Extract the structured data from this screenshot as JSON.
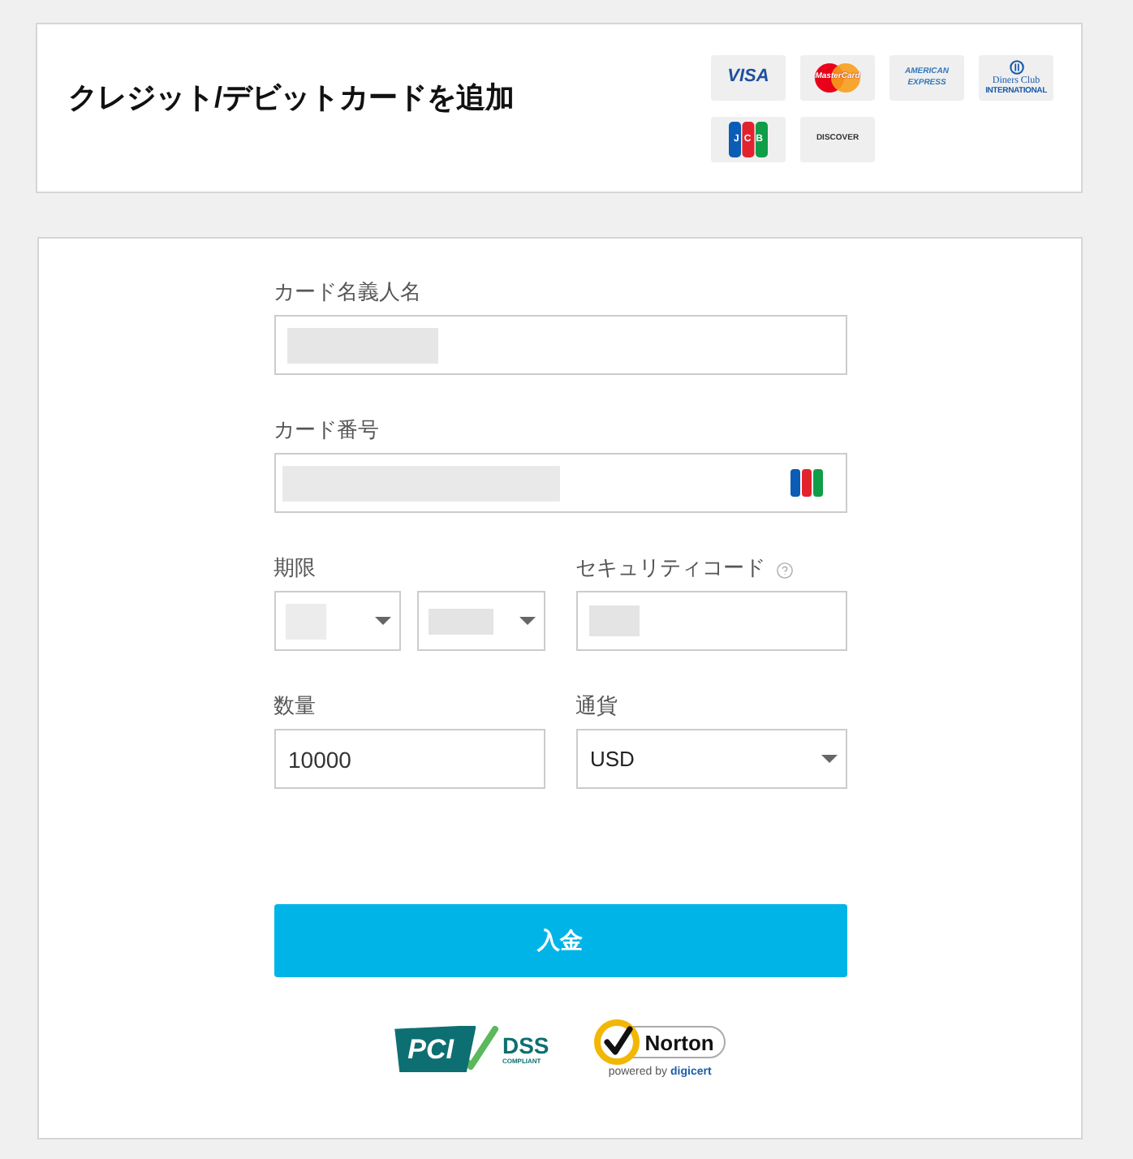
{
  "header": {
    "title": "クレジット/デビットカードを追加",
    "card_brands": [
      {
        "kind": "visa",
        "text": "VISA"
      },
      {
        "kind": "mastercard",
        "text": "MasterCard"
      },
      {
        "kind": "amex",
        "text": "AMERICAN EXPRESS"
      },
      {
        "kind": "diners",
        "text": "Diners Club",
        "subtext": "INTERNATIONAL"
      },
      {
        "kind": "jcb",
        "text": "JCB"
      },
      {
        "kind": "discover",
        "text": "DISCOVER"
      }
    ]
  },
  "form": {
    "cardholder": {
      "label": "カード名義人名",
      "masked": true
    },
    "card_number": {
      "label": "カード番号",
      "masked": true,
      "card_icon": true
    },
    "expiry": {
      "label": "期限",
      "selects": [
        {
          "masked": true
        },
        {
          "masked": true
        }
      ]
    },
    "security_code": {
      "label": "セキュリティコード",
      "help": true,
      "masked": true
    },
    "amount": {
      "label": "数量",
      "value": "10000"
    },
    "currency": {
      "label": "通貨",
      "value": "USD"
    },
    "submit": {
      "label": "入金"
    }
  },
  "trust_badges": [
    {
      "kind": "pci",
      "mark": "PCI",
      "text": "DSS",
      "subtext": "COMPLIANT"
    },
    {
      "kind": "norton",
      "text": "Norton",
      "subtext": "powered by",
      "brand": "digicert"
    }
  ]
}
